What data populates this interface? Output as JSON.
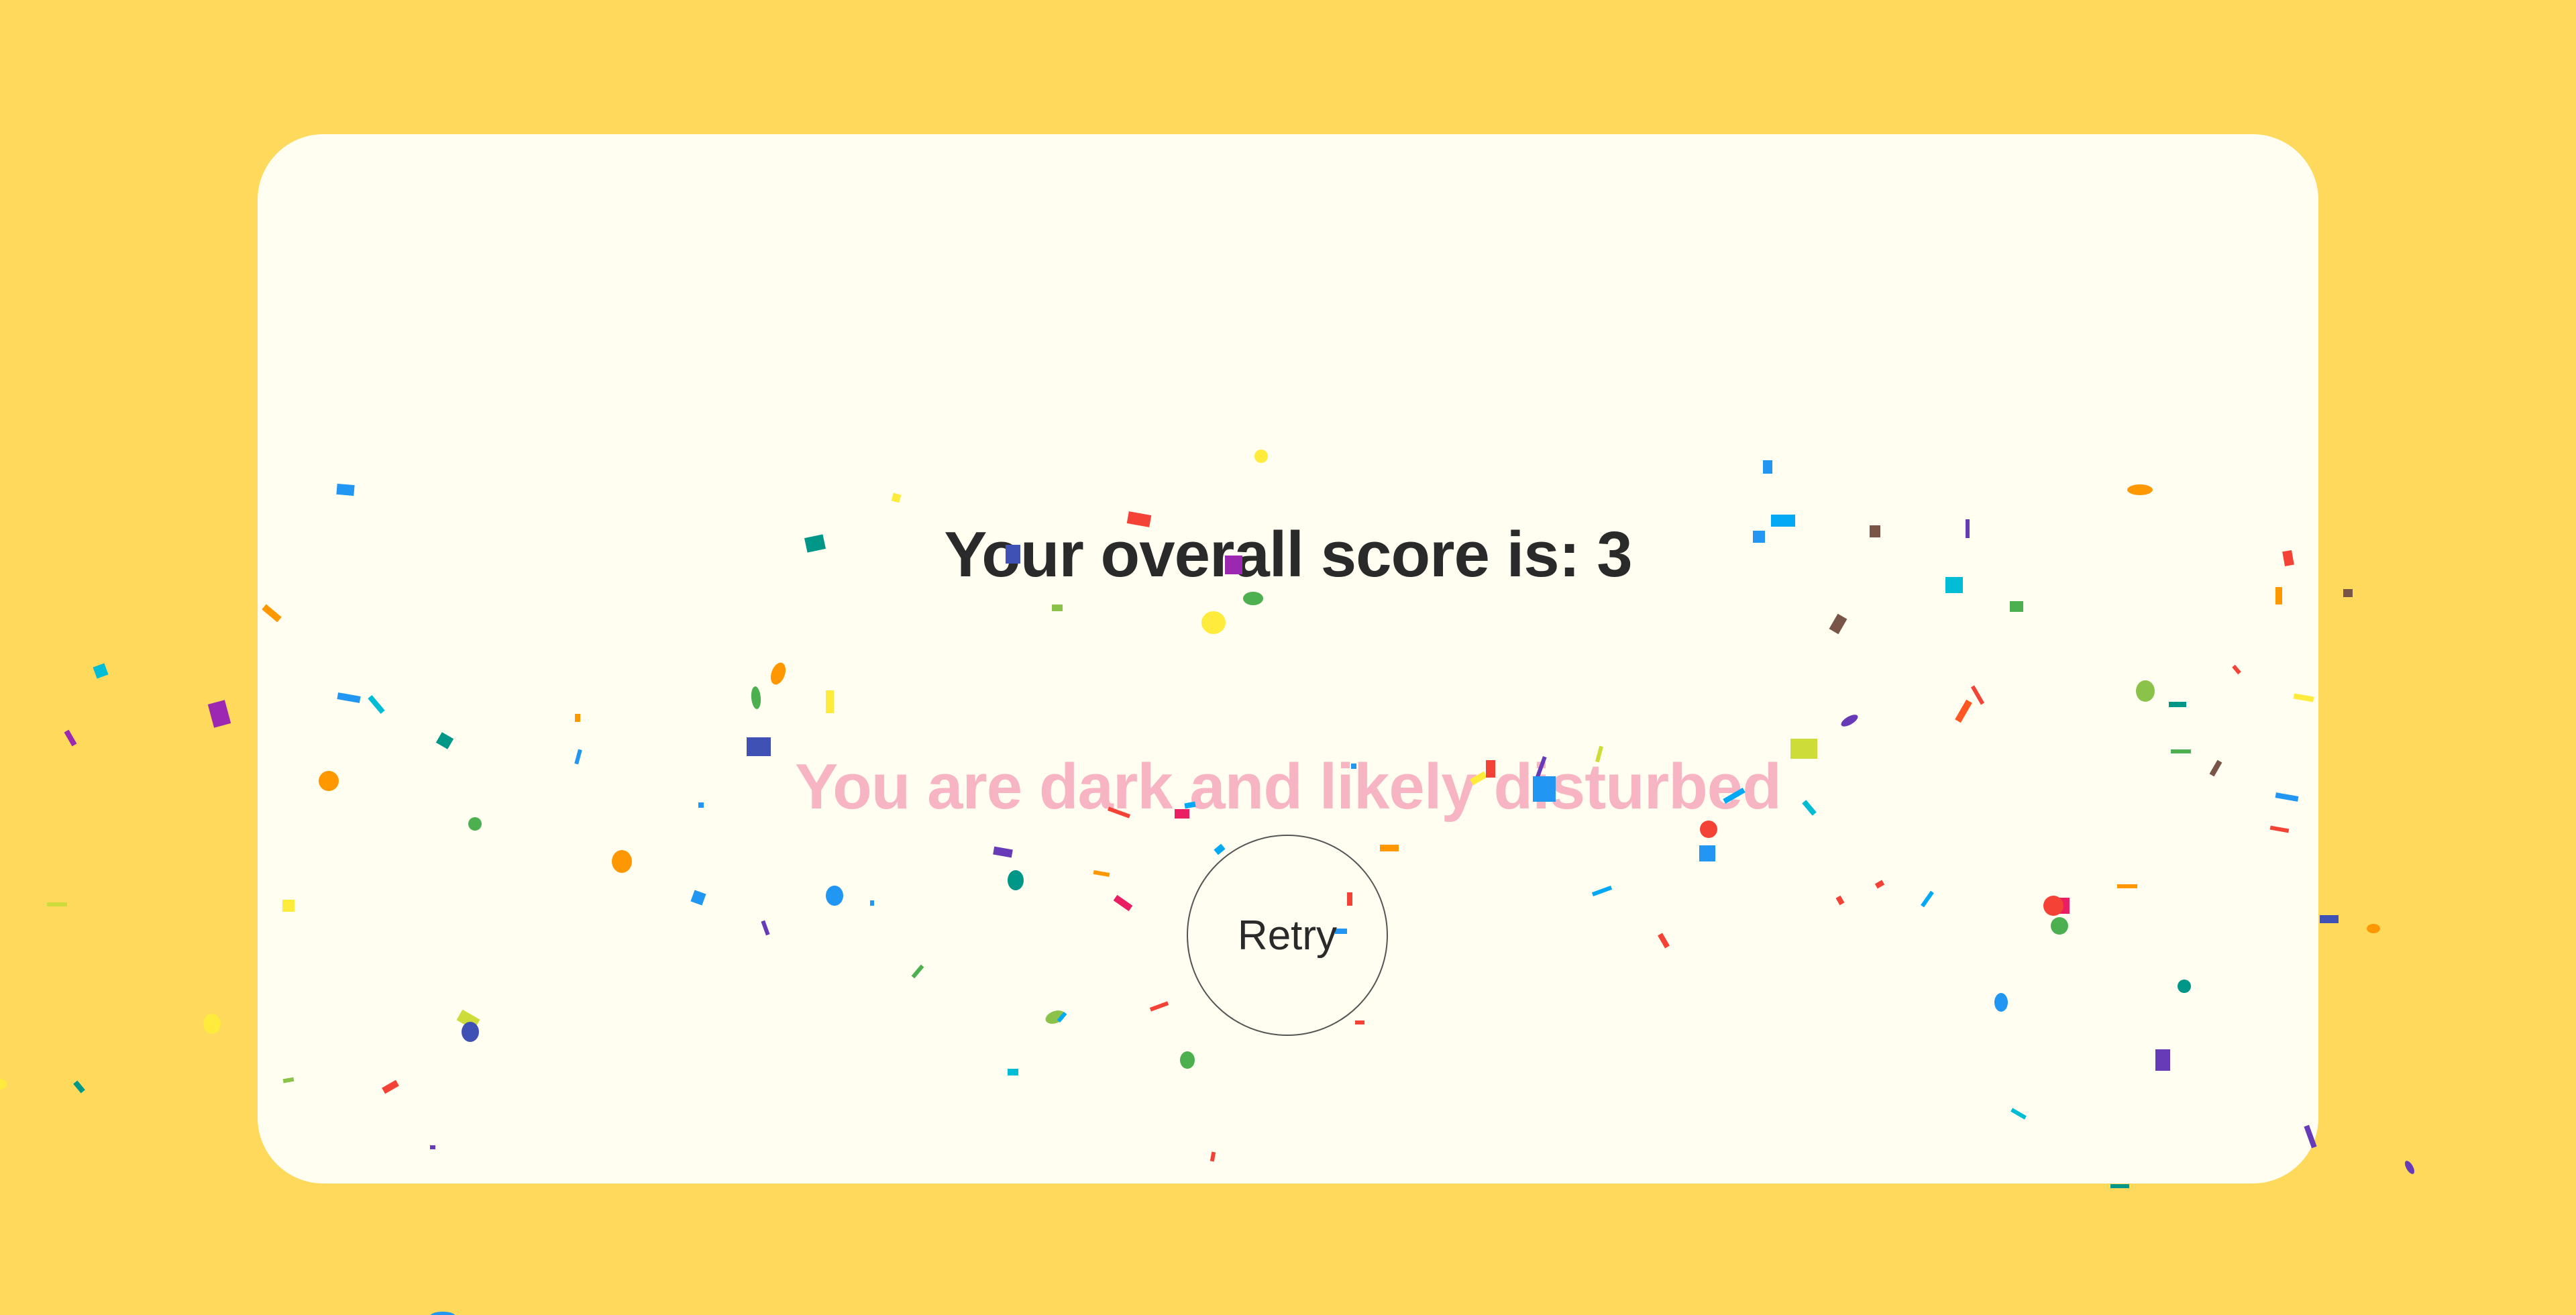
{
  "result": {
    "score_text": "Your overall score is: 3",
    "verdict_text": "You are dark and likely disturbed",
    "retry_label": "Retry"
  },
  "colors": {
    "page_background": "#FED95C",
    "card_background": "#FFFEF0",
    "score_text": "#2A2A2A",
    "verdict_text": "#F7B4C3",
    "confetti_palette": [
      "#F44336",
      "#E91E63",
      "#9C27B0",
      "#673AB7",
      "#3F51B5",
      "#2196F3",
      "#03A9F4",
      "#00BCD4",
      "#009688",
      "#4CAF50",
      "#8BC34A",
      "#CDDC39",
      "#FFEB3B",
      "#FF9800",
      "#FF5722",
      "#795548"
    ]
  },
  "decoration": {
    "confetti": "confetti-particles"
  }
}
